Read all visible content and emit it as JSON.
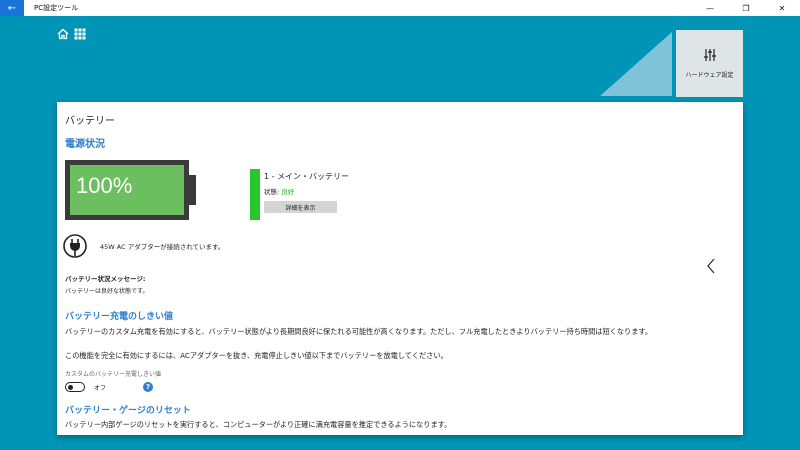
{
  "window": {
    "title": "PC設定ツール",
    "back_glyph": "←",
    "minimize_glyph": "—",
    "restore_glyph": "❐",
    "close_glyph": "✕"
  },
  "nav": {
    "home_icon": "home-icon",
    "apps_icon": "grid-icon"
  },
  "hardware_tile": {
    "label": "ハードウェア設定",
    "icon": "sliders-icon"
  },
  "page": {
    "title": "バッテリー",
    "power_status_heading": "電源状況"
  },
  "battery": {
    "percent_text": "100%",
    "level": 1.0,
    "fill_color": "#6cbf5e",
    "name": "1 - メイン・バッテリー",
    "status_label": "状態:",
    "status_value": "良好",
    "status_color": "#26b52b",
    "details_button": "詳細を表示"
  },
  "adapter": {
    "text": "45W AC アダプターが接続されています。",
    "icon": "plug-icon"
  },
  "message": {
    "title": "バッテリー状況メッセージ:",
    "text": "バッテリーは良好な状態です。"
  },
  "threshold": {
    "heading": "バッテリー充電のしきい値",
    "para1": "バッテリーのカスタム充電を有効にすると、バッテリー状態がより長期間良好に保たれる可能性が高くなります。ただし、フル充電したときよりバッテリー持ち時間は短くなります。",
    "para2": "この機能を完全に有効にするには、ACアダプターを抜き、充電停止しきい値以下までバッテリーを放電してください。",
    "custom_label": "カスタムのバッテリー充電しきい値",
    "toggle_state": "オフ",
    "help_glyph": "?"
  },
  "reset": {
    "heading": "バッテリー・ゲージのリセット",
    "para": "バッテリー内部ゲージのリセットを実行すると、コンピューターがより正確に満充電容量を推定できるようになります。"
  },
  "colors": {
    "background": "#0095b6",
    "accent": "#2e7fcf",
    "good": "#26c82b"
  }
}
